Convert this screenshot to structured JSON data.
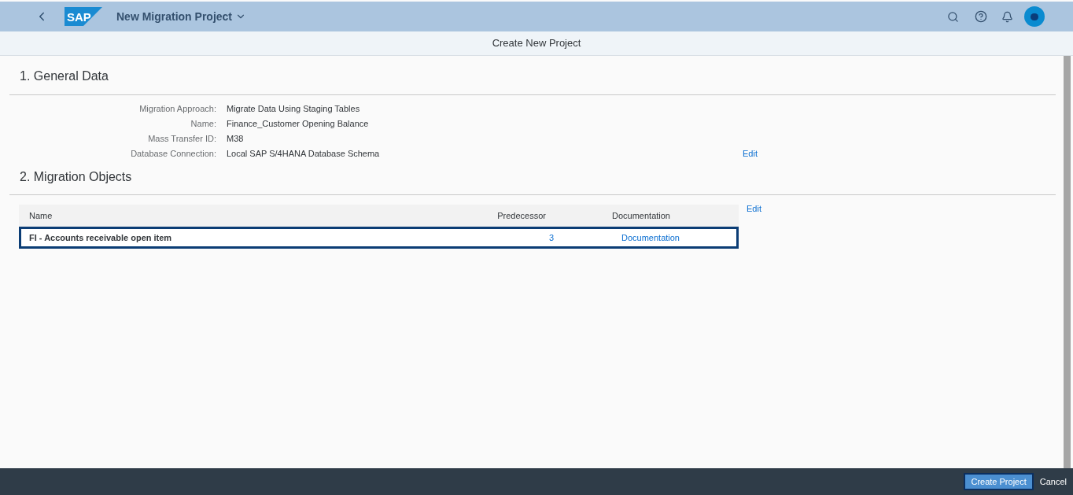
{
  "shell": {
    "logo": "SAP",
    "title": "New Migration Project"
  },
  "subheader": {
    "title": "Create New Project"
  },
  "general_data": {
    "title": "1. General Data",
    "fields": [
      {
        "label": "Migration Approach:",
        "value": "Migrate Data Using Staging Tables"
      },
      {
        "label": "Name:",
        "value": "Finance_Customer Opening Balance"
      },
      {
        "label": "Mass Transfer ID:",
        "value": "M38"
      },
      {
        "label": "Database Connection:",
        "value": "Local SAP S/4HANA Database Schema"
      }
    ],
    "edit_link": "Edit"
  },
  "migration_objects": {
    "title": "2. Migration Objects",
    "edit_link": "Edit",
    "columns": [
      "Name",
      "Predecessor",
      "Documentation"
    ],
    "rows": [
      {
        "name": "FI - Accounts receivable open item",
        "predecessor": "3",
        "documentation": "Documentation",
        "selected": true
      }
    ]
  },
  "footer": {
    "buttons": [
      "Create Project",
      "Cancel"
    ]
  }
}
